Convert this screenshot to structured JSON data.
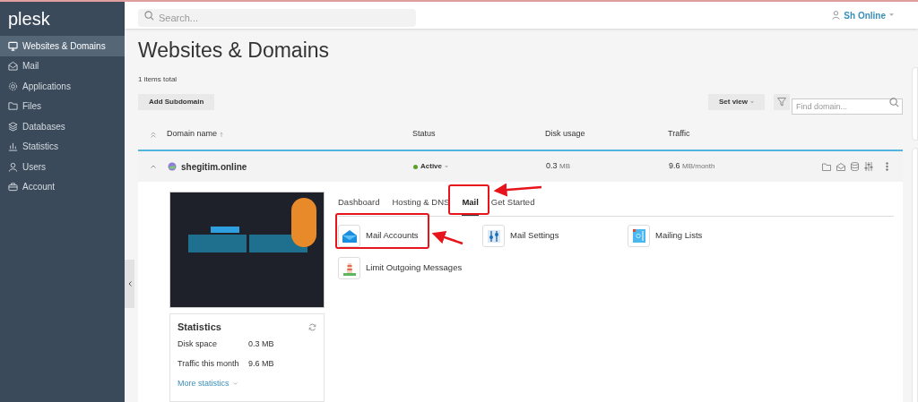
{
  "sidebar": {
    "logo": "plesk",
    "items": [
      {
        "label": "Websites & Domains",
        "selected": true
      },
      {
        "label": "Mail",
        "selected": false
      },
      {
        "label": "Applications",
        "selected": false
      },
      {
        "label": "Files",
        "selected": false
      },
      {
        "label": "Databases",
        "selected": false
      },
      {
        "label": "Statistics",
        "selected": false
      },
      {
        "label": "Users",
        "selected": false
      },
      {
        "label": "Account",
        "selected": false
      }
    ]
  },
  "header": {
    "search_placeholder": "Search...",
    "user": "Sh Online"
  },
  "page": {
    "title": "Websites & Domains",
    "count": "1 items total",
    "add_button": "Add Subdomain",
    "set_view": "Set view",
    "find_placeholder": "Find domain..."
  },
  "table": {
    "columns": [
      "Domain name",
      "Status",
      "Disk usage",
      "Traffic"
    ],
    "rows": [
      {
        "domain": "shegitim.online",
        "status": "Active",
        "disk": "0.3",
        "disk_unit": "MB",
        "traffic": "9.6",
        "traffic_unit": "MB/month",
        "expanded": true
      }
    ]
  },
  "details": {
    "statistics": {
      "title": "Statistics",
      "rows": [
        {
          "label": "Disk space",
          "value": "0.3 MB"
        },
        {
          "label": "Traffic this month",
          "value": "9.6 MB"
        }
      ],
      "more": "More statistics"
    },
    "tabs": [
      {
        "label": "Dashboard",
        "selected": false
      },
      {
        "label": "Hosting & DNS",
        "selected": false
      },
      {
        "label": "Mail",
        "selected": true
      },
      {
        "label": "Get Started",
        "selected": false
      }
    ],
    "tools": [
      {
        "label": "Mail Accounts"
      },
      {
        "label": "Mail Settings"
      },
      {
        "label": "Mailing Lists"
      },
      {
        "label": "Limit Outgoing Messages"
      }
    ]
  }
}
